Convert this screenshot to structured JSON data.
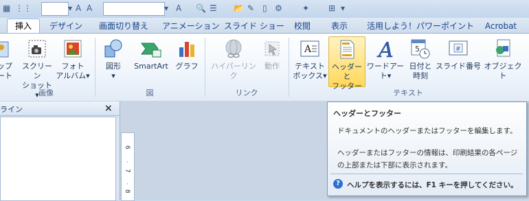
{
  "tabs": [
    {
      "label": "挿入",
      "active": true
    },
    {
      "label": "デザイン"
    },
    {
      "label": "画面切り替え"
    },
    {
      "label": "アニメーション"
    },
    {
      "label": "スライド ショー"
    },
    {
      "label": "校閲"
    },
    {
      "label": "表示"
    },
    {
      "label": "活用しよう！パワーポイント"
    },
    {
      "label": "Acrobat"
    }
  ],
  "ribbon": {
    "image_group": {
      "clipart_partial_1": "ップ",
      "clipart_partial_2": "ート",
      "screenshot_1": "スクリーン",
      "screenshot_2": "ショット",
      "photoalbum_1": "フォト",
      "photoalbum_2": "アルバム",
      "label": "画像"
    },
    "figure_group": {
      "shapes": "図形",
      "smartart": "SmartArt",
      "chart": "グラフ",
      "label": "図"
    },
    "link_group": {
      "hyperlink": "ハイパーリンク",
      "action": "動作",
      "label": "リンク"
    },
    "text_group": {
      "textbox_1": "テキスト",
      "textbox_2": "ボックス",
      "headerfooter_1": "ヘッダーと",
      "headerfooter_2": "フッター",
      "wordart": "ワードアート",
      "datetime_1": "日付と",
      "datetime_2": "時刻",
      "slidenum": "スライド番号",
      "object": "オブジェクト",
      "label": "テキスト"
    }
  },
  "outline_panel": {
    "tab_label": "ライン",
    "close": "×"
  },
  "ruler": {
    "marks": [
      "6",
      "7",
      "8"
    ]
  },
  "tooltip": {
    "title": "ヘッダーとフッター",
    "description": "ドキュメントのヘッダーまたはフッターを編集します。",
    "detail_1": "ヘッダーまたはフッターの情報は、印刷結果の各ページ",
    "detail_2": "の上部または下部に表示されます。",
    "help": "ヘルプを表示するには、F1 キーを押してください。"
  },
  "colors": {
    "accent": "#15428b",
    "tooltip_border": "#7f9db9",
    "hover": "#ffd75a",
    "help_icon": "#2e6fd1"
  }
}
